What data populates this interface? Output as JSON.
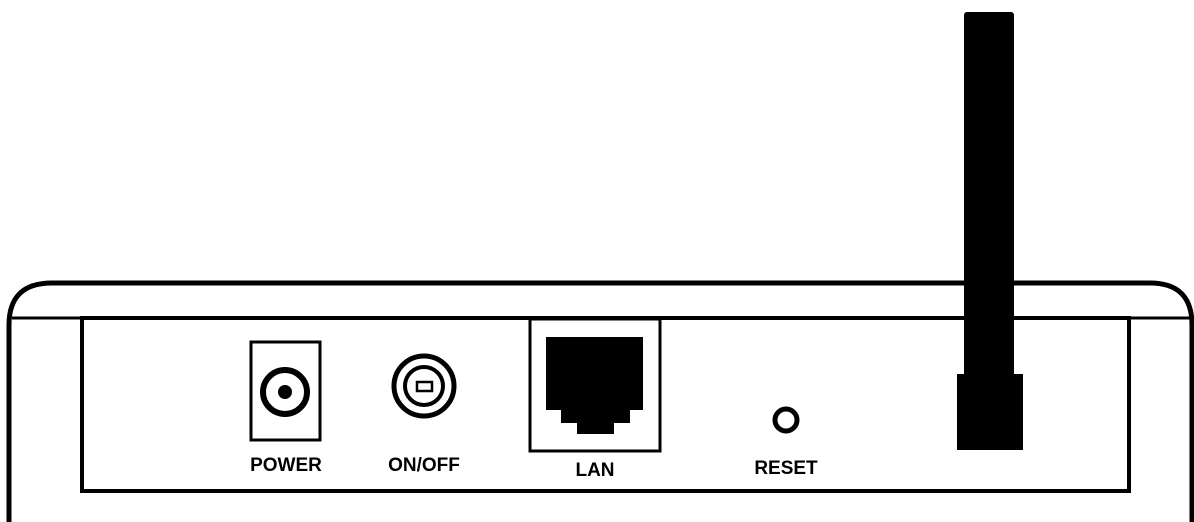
{
  "device": {
    "view": "rear panel",
    "colors": {
      "outline": "#000000",
      "fill": "#ffffff",
      "antenna": "#000000"
    },
    "ports": [
      {
        "id": "power",
        "label": "POWER",
        "icon": "power-jack-icon"
      },
      {
        "id": "onoff",
        "label": "ON/OFF",
        "icon": "power-switch-icon"
      },
      {
        "id": "lan",
        "label": "LAN",
        "icon": "ethernet-port-icon"
      },
      {
        "id": "reset",
        "label": "RESET",
        "icon": "reset-pinhole-icon"
      }
    ],
    "antenna": {
      "icon": "antenna-icon"
    }
  }
}
